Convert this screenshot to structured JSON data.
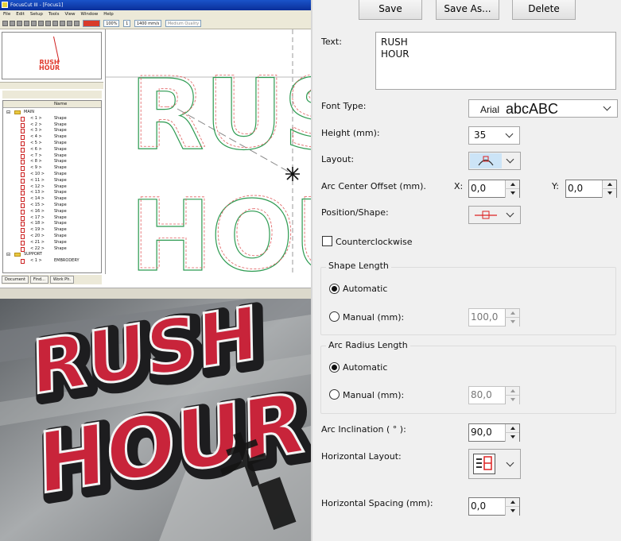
{
  "app": {
    "title": "FocusCut III - [Focus1]",
    "menu": [
      "File",
      "Edit",
      "Setup",
      "Tools",
      "View",
      "Window",
      "Help"
    ],
    "toolbar": {
      "zoom": "100%",
      "layer": "1",
      "speed": "1400 mm/s",
      "quality": "Medium Quality"
    },
    "preview_text": "RUSH\nHOUR",
    "tree": {
      "column_header": "Name",
      "groups": [
        {
          "label": "MAIN",
          "items": [
            {
              "id": "< 1 >",
              "type": "Shape"
            },
            {
              "id": "< 2 >",
              "type": "Shape"
            },
            {
              "id": "< 3 >",
              "type": "Shape"
            },
            {
              "id": "< 4 >",
              "type": "Shape"
            },
            {
              "id": "< 5 >",
              "type": "Shape"
            },
            {
              "id": "< 6 >",
              "type": "Shape"
            },
            {
              "id": "< 7 >",
              "type": "Shape"
            },
            {
              "id": "< 8 >",
              "type": "Shape"
            },
            {
              "id": "< 9 >",
              "type": "Shape"
            },
            {
              "id": "< 10 >",
              "type": "Shape"
            },
            {
              "id": "< 11 >",
              "type": "Shape"
            },
            {
              "id": "< 12 >",
              "type": "Shape"
            },
            {
              "id": "< 13 >",
              "type": "Shape"
            },
            {
              "id": "< 14 >",
              "type": "Shape"
            },
            {
              "id": "< 15 >",
              "type": "Shape"
            },
            {
              "id": "< 16 >",
              "type": "Shape"
            },
            {
              "id": "< 17 >",
              "type": "Shape"
            },
            {
              "id": "< 18 >",
              "type": "Shape"
            },
            {
              "id": "< 19 >",
              "type": "Shape"
            },
            {
              "id": "< 20 >",
              "type": "Shape"
            },
            {
              "id": "< 21 >",
              "type": "Shape"
            },
            {
              "id": "< 22 >",
              "type": "Shape"
            }
          ]
        },
        {
          "label": "SUPPORT",
          "items": [
            {
              "id": "< 1 >",
              "type": "EMBRODERY"
            }
          ]
        }
      ]
    },
    "tabs": [
      "Document",
      "Find...",
      "Work Ph."
    ],
    "canvas_text": [
      "RUS",
      "HOU"
    ],
    "photo_text": [
      "RUSH",
      "HOUR"
    ]
  },
  "dialog": {
    "buttons": {
      "save": "Save",
      "save_as": "Save As...",
      "delete": "Delete"
    },
    "text_label": "Text:",
    "text_value": "RUSH\nHOUR",
    "font_type": {
      "label": "Font Type:",
      "font": "Arial",
      "sample": "abcABC"
    },
    "height": {
      "label": "Height (mm):",
      "value": "35"
    },
    "layout_label": "Layout:",
    "arc_center": {
      "label": "Arc Center Offset (mm).",
      "x_label": "X:",
      "x_value": "0,0",
      "y_label": "Y:",
      "y_value": "0,0"
    },
    "position_shape_label": "Position/Shape:",
    "ccw_label": "Counterclockwise",
    "shape_length": {
      "title": "Shape Length",
      "automatic": "Automatic",
      "manual": "Manual (mm):",
      "manual_value": "100,0"
    },
    "arc_radius": {
      "title": "Arc Radius Length",
      "automatic": "Automatic",
      "manual": "Manual (mm):",
      "manual_value": "80,0"
    },
    "arc_inclination": {
      "label": "Arc Inclination ( ° ):",
      "value": "90,0"
    },
    "horizontal_layout_label": "Horizontal Layout:",
    "horizontal_spacing": {
      "label": "Horizontal Spacing (mm):",
      "value": "0,0"
    }
  },
  "colors": {
    "accent": "#e03a2c",
    "outline_green": "#2e9b52",
    "title_blue": "#0a3bb0",
    "patch_red": "#c8243a"
  }
}
